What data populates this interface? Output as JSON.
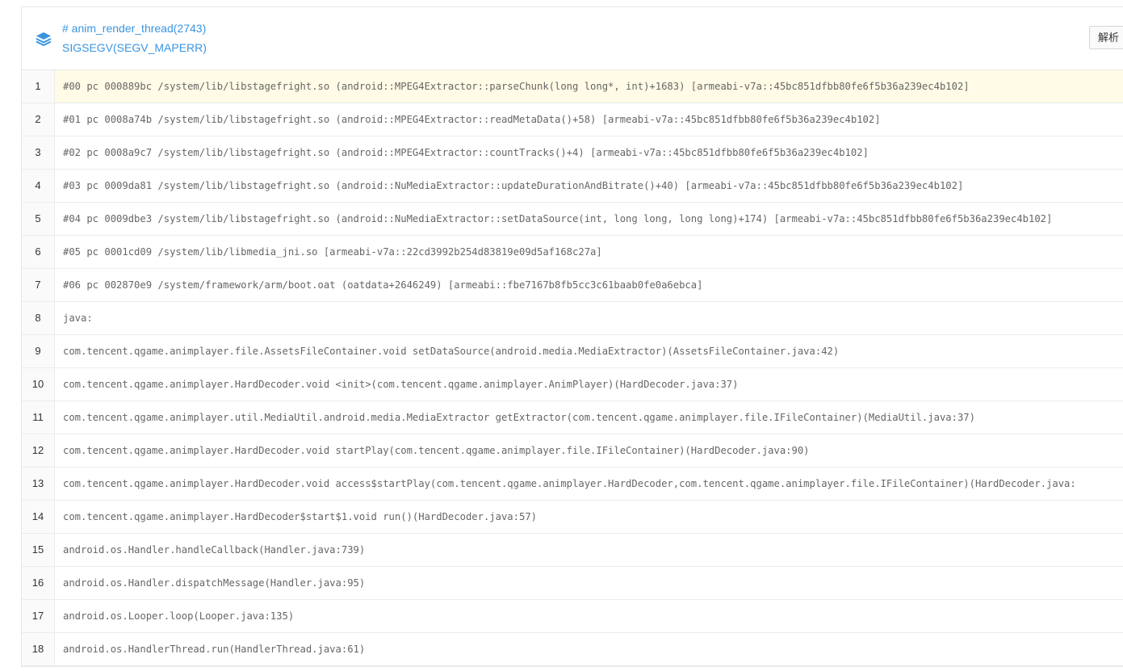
{
  "header": {
    "icon": "layers-icon",
    "thread_title": "# anim_render_thread(2743)",
    "signal": "SIGSEGV(SEGV_MAPERR)",
    "parse_button_label": "解析"
  },
  "colors": {
    "link_blue": "#3a95e0",
    "highlight_row": "#fffbe6"
  },
  "stack_lines": [
    {
      "num": "1",
      "text": "#00 pc 000889bc /system/lib/libstagefright.so (android::MPEG4Extractor::parseChunk(long long*, int)+1683) [armeabi-v7a::45bc851dfbb80fe6f5b36a239ec4b102]",
      "highlighted": true
    },
    {
      "num": "2",
      "text": "#01 pc 0008a74b /system/lib/libstagefright.so (android::MPEG4Extractor::readMetaData()+58) [armeabi-v7a::45bc851dfbb80fe6f5b36a239ec4b102]"
    },
    {
      "num": "3",
      "text": "#02 pc 0008a9c7 /system/lib/libstagefright.so (android::MPEG4Extractor::countTracks()+4) [armeabi-v7a::45bc851dfbb80fe6f5b36a239ec4b102]"
    },
    {
      "num": "4",
      "text": "#03 pc 0009da81 /system/lib/libstagefright.so (android::NuMediaExtractor::updateDurationAndBitrate()+40) [armeabi-v7a::45bc851dfbb80fe6f5b36a239ec4b102]"
    },
    {
      "num": "5",
      "text": "#04 pc 0009dbe3 /system/lib/libstagefright.so (android::NuMediaExtractor::setDataSource(int, long long, long long)+174) [armeabi-v7a::45bc851dfbb80fe6f5b36a239ec4b102]"
    },
    {
      "num": "6",
      "text": "#05 pc 0001cd09 /system/lib/libmedia_jni.so [armeabi-v7a::22cd3992b254d83819e09d5af168c27a]"
    },
    {
      "num": "7",
      "text": "#06 pc 002870e9 /system/framework/arm/boot.oat (oatdata+2646249) [armeabi::fbe7167b8fb5cc3c61baab0fe0a6ebca]"
    },
    {
      "num": "8",
      "text": "java:"
    },
    {
      "num": "9",
      "text": "com.tencent.qgame.animplayer.file.AssetsFileContainer.void setDataSource(android.media.MediaExtractor)(AssetsFileContainer.java:42)"
    },
    {
      "num": "10",
      "text": "com.tencent.qgame.animplayer.HardDecoder.void <init>(com.tencent.qgame.animplayer.AnimPlayer)(HardDecoder.java:37)"
    },
    {
      "num": "11",
      "text": "com.tencent.qgame.animplayer.util.MediaUtil.android.media.MediaExtractor getExtractor(com.tencent.qgame.animplayer.file.IFileContainer)(MediaUtil.java:37)"
    },
    {
      "num": "12",
      "text": "com.tencent.qgame.animplayer.HardDecoder.void startPlay(com.tencent.qgame.animplayer.file.IFileContainer)(HardDecoder.java:90)"
    },
    {
      "num": "13",
      "text": "com.tencent.qgame.animplayer.HardDecoder.void access$startPlay(com.tencent.qgame.animplayer.HardDecoder,com.tencent.qgame.animplayer.file.IFileContainer)(HardDecoder.java:"
    },
    {
      "num": "14",
      "text": "com.tencent.qgame.animplayer.HardDecoder$start$1.void run()(HardDecoder.java:57)"
    },
    {
      "num": "15",
      "text": "android.os.Handler.handleCallback(Handler.java:739)"
    },
    {
      "num": "16",
      "text": "android.os.Handler.dispatchMessage(Handler.java:95)"
    },
    {
      "num": "17",
      "text": "android.os.Looper.loop(Looper.java:135)"
    },
    {
      "num": "18",
      "text": "android.os.HandlerThread.run(HandlerThread.java:61)"
    }
  ]
}
